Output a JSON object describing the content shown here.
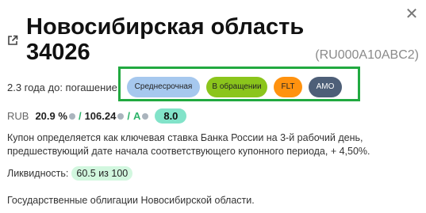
{
  "header": {
    "title": "Новосибирская область 34026",
    "isin": "(RU000A10ABC2)",
    "close_icon": "close-icon",
    "link_icon": "external-link-icon"
  },
  "maturity": "2.3 года до: погашение",
  "tags": [
    {
      "label": "Среднесрочная",
      "color": "#a6c8ee"
    },
    {
      "label": "В обращении",
      "color": "#8bc51c"
    },
    {
      "label": "FLT",
      "color": "#ff920f"
    },
    {
      "label": "AMO",
      "color": "#4e5f78"
    }
  ],
  "highlight_color": "#21a940",
  "stats": {
    "currency": "RUB",
    "yield": "20.9 %",
    "price": "106.24",
    "rating": "A",
    "score": "8.0",
    "accent_color": "#2db36a"
  },
  "coupon_description": "Купон определяется как ключевая ставка Банка России на 3-й рабочий день, предшествующий дате начала соответствующего купонного периода, + 4,50%.",
  "liquidity": {
    "label": "Ликвидность:",
    "value": "60.5 из 100"
  },
  "issuer_description": "Государственные облигации Новосибирской области."
}
